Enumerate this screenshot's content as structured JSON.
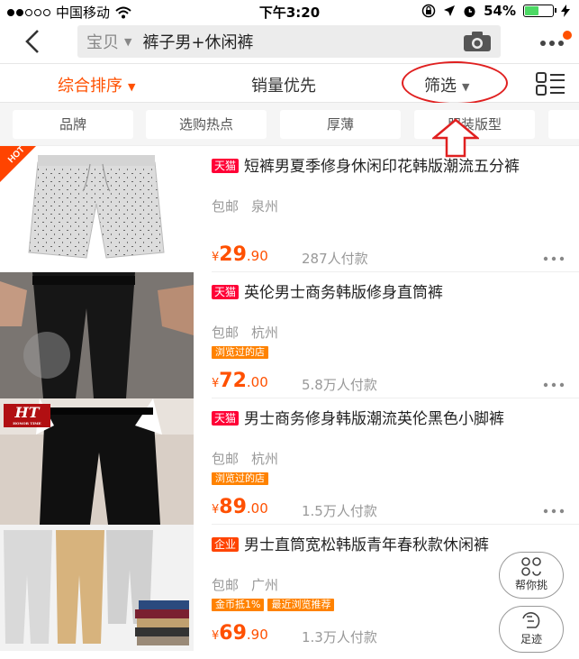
{
  "status": {
    "carrier": "中国移动",
    "time": "下午3:20",
    "battery": "54%",
    "battery_level": 0.54
  },
  "search": {
    "scope": "宝贝",
    "query": "裤子男+休闲裤"
  },
  "sort": {
    "items": [
      "综合排序",
      "销量优先",
      "筛选"
    ]
  },
  "chips": [
    "品牌",
    "选购热点",
    "厚薄",
    "服装版型"
  ],
  "products": [
    {
      "badge": "天猫",
      "title": "短裤男夏季修身休闲印花韩版潮流五分裤",
      "shipping": "包邮",
      "location": "泉州",
      "tags": [],
      "price_int": "29",
      "price_dec": ".90",
      "currency": "¥",
      "sales": "287人付款",
      "ribbon": "HOT"
    },
    {
      "badge": "天猫",
      "title": "英伦男士商务韩版修身直筒裤",
      "shipping": "包邮",
      "location": "杭州",
      "tags": [
        "浏览过的店"
      ],
      "price_int": "72",
      "price_dec": ".00",
      "currency": "¥",
      "sales": "5.8万人付款"
    },
    {
      "badge": "天猫",
      "title": "男士商务修身韩版潮流英伦黑色小脚裤",
      "shipping": "包邮",
      "location": "杭州",
      "tags": [
        "浏览过的店"
      ],
      "price_int": "89",
      "price_dec": ".00",
      "currency": "¥",
      "sales": "1.5万人付款",
      "logo": "HT",
      "logo_sub": "HONOR TIME"
    },
    {
      "badge": "企业",
      "title": "男士直筒宽松韩版青年春秋款休闲裤",
      "shipping": "包邮",
      "location": "广州",
      "tags": [
        "金币抵1%",
        "最近浏览推荐"
      ],
      "price_int": "69",
      "price_dec": ".90",
      "currency": "¥",
      "sales": "1.3万人付款"
    }
  ],
  "fabs": {
    "help": "帮你挑",
    "footprint": "足迹"
  },
  "colors": {
    "accent": "#ff5000",
    "tmall": "#ff0036",
    "annotation": "#e02020"
  }
}
